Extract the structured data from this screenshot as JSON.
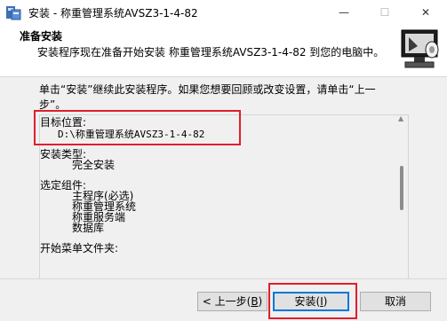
{
  "window": {
    "title": "安装 - 称重管理系统AVSZ3-1-4-82",
    "min_glyph": "—",
    "max_glyph": "☐",
    "close_glyph": "✕"
  },
  "header": {
    "title": "准备安装",
    "subtitle": "安装程序现在准备开始安装 称重管理系统AVSZ3-1-4-82 到您的电脑中。"
  },
  "main": {
    "instruction_line1": "单击“安装”继续此安装程序。如果您想要回顾或改变设置，请单击“上一",
    "instruction_line2": "步”。",
    "summary": {
      "target_label": "目标位置:",
      "target_value": "D:\\称重管理系统AVSZ3-1-4-82",
      "type_label": "安装类型:",
      "type_value": "完全安装",
      "components_label": "选定组件:",
      "components": [
        "主程序(必选)",
        "称重管理系统",
        "称重服务端",
        "数据库"
      ],
      "startmenu_label": "开始菜单文件夹:"
    },
    "scroll_up_glyph": "▲",
    "scroll_down_glyph": "▼"
  },
  "footer": {
    "back_prefix": "< 上一步(",
    "back_key": "B",
    "back_suffix": ")",
    "install_prefix": "安装(",
    "install_key": "I",
    "install_suffix": ")",
    "cancel_label": "取消"
  }
}
